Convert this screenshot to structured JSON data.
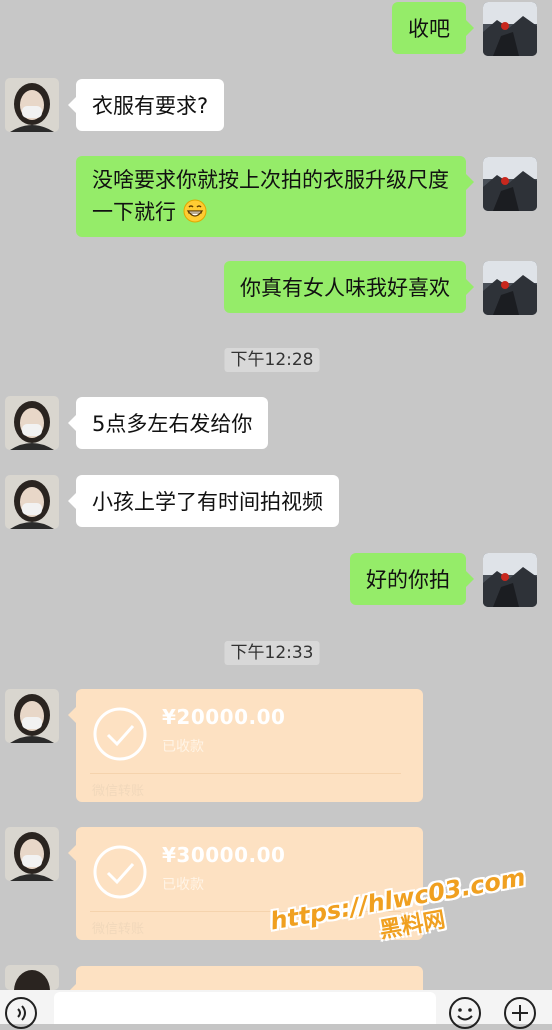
{
  "colors": {
    "chat_background": "#c7c7c7",
    "incoming_bubble": "#ffffff",
    "outgoing_bubble": "#95ec69",
    "transfer_card": "#fde1c2",
    "watermark": "#f0a020"
  },
  "messages": [
    {
      "side": "right",
      "text": "收吧"
    },
    {
      "side": "left",
      "text": "衣服有要求?"
    },
    {
      "side": "right",
      "text": "没啥要求你就按上次拍的衣服升级尺度一下就行",
      "emoji": "grinning-face-emoji"
    },
    {
      "side": "right",
      "text": "你真有女人味我好喜欢"
    },
    {
      "side": "left",
      "text": "5点多左右发给你"
    },
    {
      "side": "left",
      "text": "小孩上学了有时间拍视频"
    },
    {
      "side": "right",
      "text": "好的你拍"
    }
  ],
  "timestamps": [
    "下午12:28",
    "下午12:33"
  ],
  "transfers": [
    {
      "amount": "¥20000.00",
      "status": "已收款",
      "label": "微信转账"
    },
    {
      "amount": "¥30000.00",
      "status": "已收款",
      "label": "微信转账"
    }
  ],
  "input_bar": {
    "voice_icon": "voice-icon",
    "emoji_icon": "emoji-icon",
    "plus_icon": "plus-icon"
  },
  "watermark": {
    "url": "https://hlwc03.com",
    "brand": "黑料网"
  }
}
